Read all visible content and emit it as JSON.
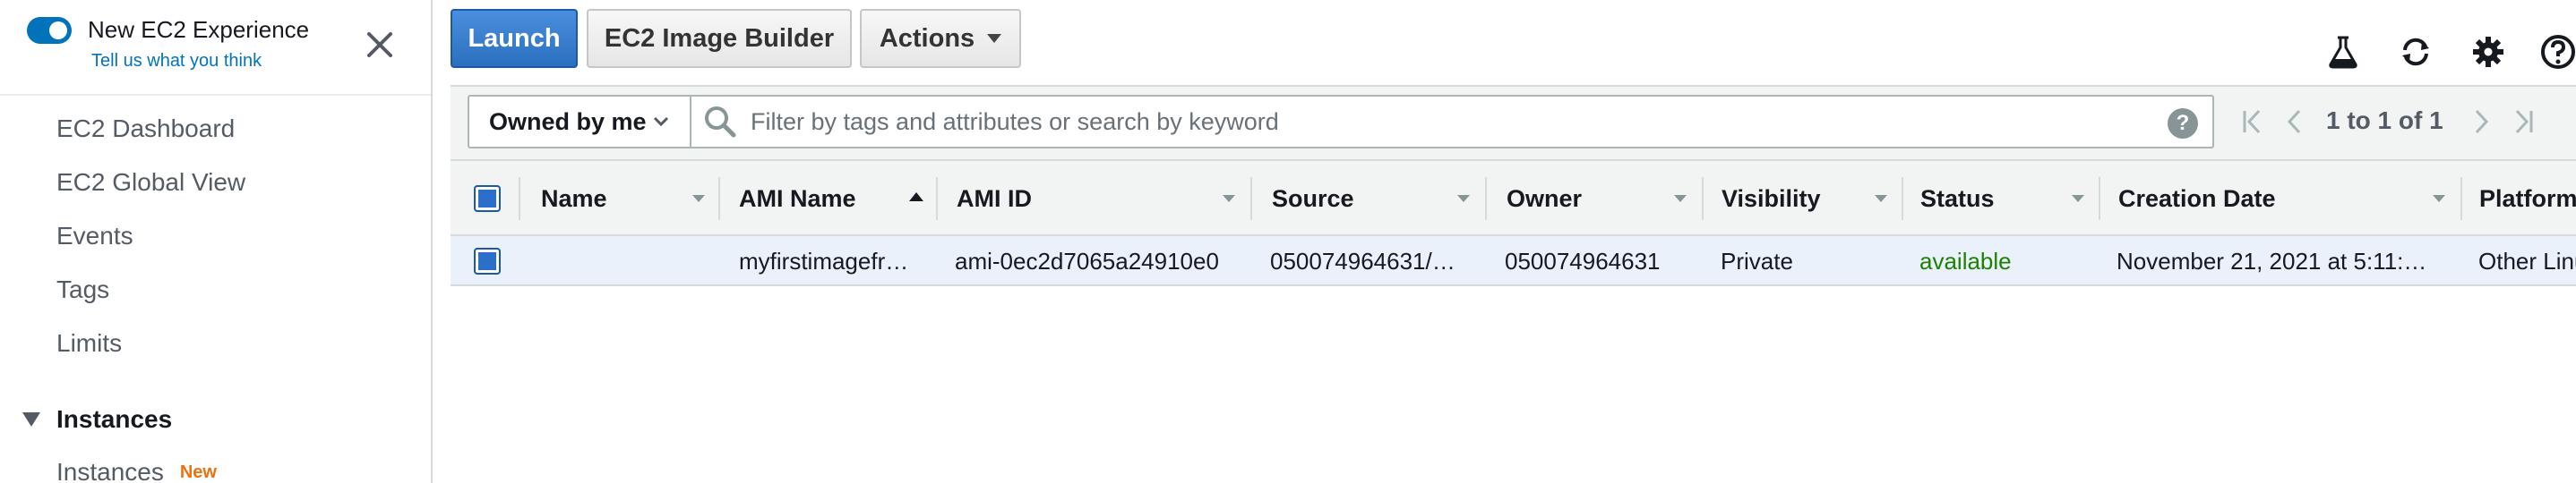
{
  "sidebar": {
    "experience_title": "New EC2 Experience",
    "experience_link": "Tell us what you think",
    "items": [
      {
        "label": "EC2 Dashboard"
      },
      {
        "label": "EC2 Global View"
      },
      {
        "label": "Events"
      },
      {
        "label": "Tags"
      },
      {
        "label": "Limits"
      }
    ],
    "section": {
      "label": "Instances"
    },
    "section_items": [
      {
        "label": "Instances",
        "badge": "New"
      }
    ]
  },
  "toolbar": {
    "launch_label": "Launch",
    "image_builder_label": "EC2 Image Builder",
    "actions_label": "Actions"
  },
  "top_icons": [
    "flask-icon",
    "refresh-icon",
    "gear-icon",
    "help-icon"
  ],
  "filter": {
    "owner_select": "Owned by me",
    "search_placeholder": "Filter by tags and attributes or search by keyword",
    "pagination": "1 to 1 of 1"
  },
  "table": {
    "columns": [
      "Name",
      "AMI Name",
      "AMI ID",
      "Source",
      "Owner",
      "Visibility",
      "Status",
      "Creation Date",
      "Platform"
    ],
    "rows": [
      {
        "name": "",
        "ami_name": "myfirstimagefr…",
        "ami_id": "ami-0ec2d7065a24910e0",
        "source": "050074964631/…",
        "owner": "050074964631",
        "visibility": "Private",
        "status": "available",
        "creation_date": "November 21, 2021 at 5:11:…",
        "platform": "Other Linu"
      }
    ]
  },
  "colors": {
    "primary": "#2b6fbf",
    "link": "#0073bb",
    "status_available": "#1d8102",
    "badge_new": "#ec7211"
  }
}
